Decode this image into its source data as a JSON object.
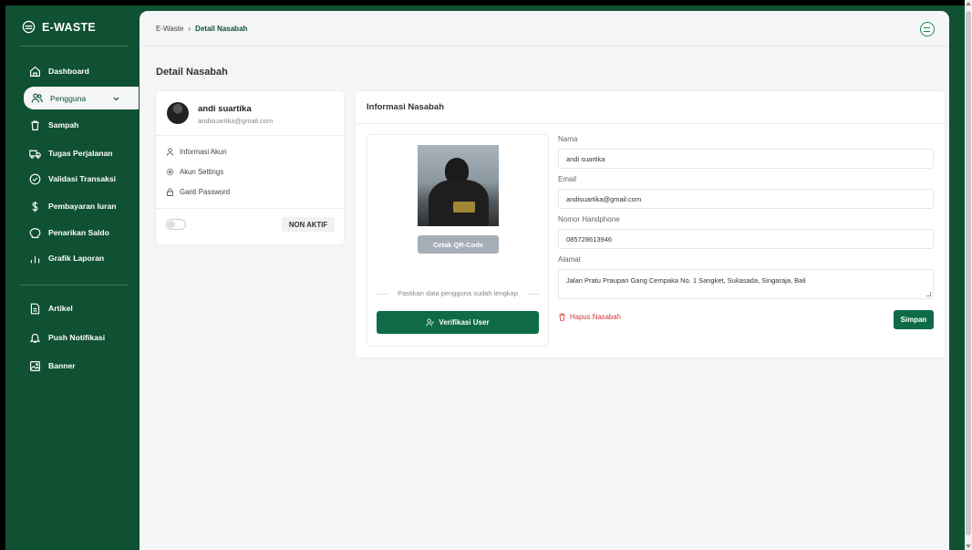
{
  "app": {
    "brand": "E-WASTE",
    "brand_icon": "recycle-logo-icon",
    "theme": {
      "sidebar_bg": "#0f5132",
      "accent": "#0f6b46",
      "danger": "#d9363e",
      "panel_bg": "#f4f5f7"
    }
  },
  "sidebar": {
    "items": [
      {
        "label": "Dashboard",
        "icon": "home-icon"
      },
      {
        "label": "Pengguna",
        "icon": "users-icon",
        "active": true
      },
      {
        "label": "Sampah",
        "icon": "trash-icon"
      },
      {
        "label": "Tugas Perjalanan",
        "icon": "truck-icon"
      },
      {
        "label": "Validasi Transaksi",
        "icon": "check-circle-icon"
      },
      {
        "label": "Pembayaran Iuran",
        "icon": "dollar-icon"
      },
      {
        "label": "Penarikan Saldo",
        "icon": "piggy-bank-icon"
      },
      {
        "label": "Grafik Laporan",
        "icon": "bar-chart-icon"
      },
      {
        "label": "Artikel",
        "icon": "document-icon"
      },
      {
        "label": "Push Notifikasi",
        "icon": "bell-icon"
      },
      {
        "label": "Banner",
        "icon": "image-icon"
      }
    ]
  },
  "header": {
    "breadcrumb_root": "E-Waste",
    "breadcrumb_sep": "›",
    "breadcrumb_current": "Detail Nasabah"
  },
  "page": {
    "title": "Detail Nasabah"
  },
  "profile": {
    "name": "andi suartika",
    "email": "andisuartika@gmail.com",
    "links": [
      {
        "label": "Informasi Akun",
        "icon": "user-icon"
      },
      {
        "label": "Akun Settings",
        "icon": "gear-icon"
      },
      {
        "label": "Ganti Password",
        "icon": "lock-icon"
      }
    ],
    "status": "NON AKTIF"
  },
  "info": {
    "title": "Informasi Nasabah",
    "qr_button": "Cetak QR-Code",
    "hint": "Pastikan data pengguna sudah lengkap",
    "verify_button": "Verifikasi User",
    "fields": {
      "name_label": "Nama",
      "name_value": "andi suartika",
      "email_label": "Email",
      "email_value": "andisuartika@gmail.com",
      "phone_label": "Nomor Handphone",
      "phone_value": "085728613946",
      "address_label": "Alamat",
      "address_value": "Jalan Pratu Praupan Gang Cempaka No. 1 Sangket, Sukasada, Singaraja, Bali"
    },
    "delete_link": "Hapus Nasabah",
    "save_button": "Simpan"
  }
}
